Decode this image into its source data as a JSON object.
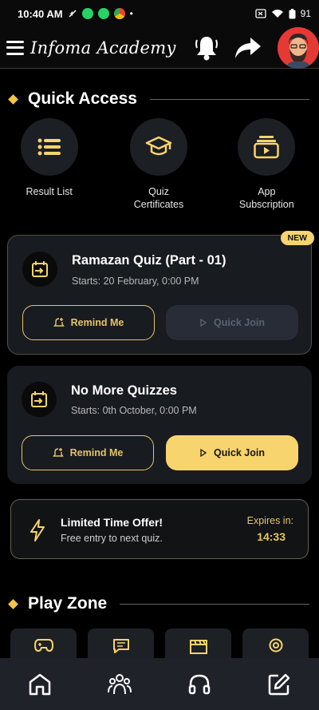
{
  "status_bar": {
    "time": "10:40 AM",
    "battery": "91"
  },
  "header": {
    "brand": "Infoma Academy"
  },
  "quick_access": {
    "title": "Quick Access",
    "items": [
      {
        "label": "Result List",
        "icon": "list-icon"
      },
      {
        "label": "Quiz\nCertificates",
        "icon": "graduation-cap-icon"
      },
      {
        "label": "App\nSubscription",
        "icon": "video-subscription-icon"
      }
    ]
  },
  "quizzes": [
    {
      "title": "Ramazan Quiz (Part - 01)",
      "starts": "Starts: 20 February, 0:00 PM",
      "badge": "NEW",
      "remind_label": "Remind Me",
      "join_label": "Quick Join",
      "join_enabled": false
    },
    {
      "title": "No More Quizzes",
      "starts": "Starts: 0th October, 0:00 PM",
      "remind_label": "Remind Me",
      "join_label": "Quick Join",
      "join_enabled": true
    }
  ],
  "offer": {
    "title": "Limited Time Offer!",
    "subtitle": "Free entry to next quiz.",
    "expires_label": "Expires in:",
    "expires_value": "14:33"
  },
  "play_zone": {
    "title": "Play Zone",
    "tiles": [
      "gamepad-icon",
      "chat-icon",
      "clapperboard-icon",
      "location-icon"
    ]
  },
  "bottom_nav": [
    "home-icon",
    "users-icon",
    "headphones-icon",
    "edit-icon"
  ],
  "colors": {
    "accent": "#f7d46d",
    "background": "#000000",
    "card": "#181b20"
  }
}
